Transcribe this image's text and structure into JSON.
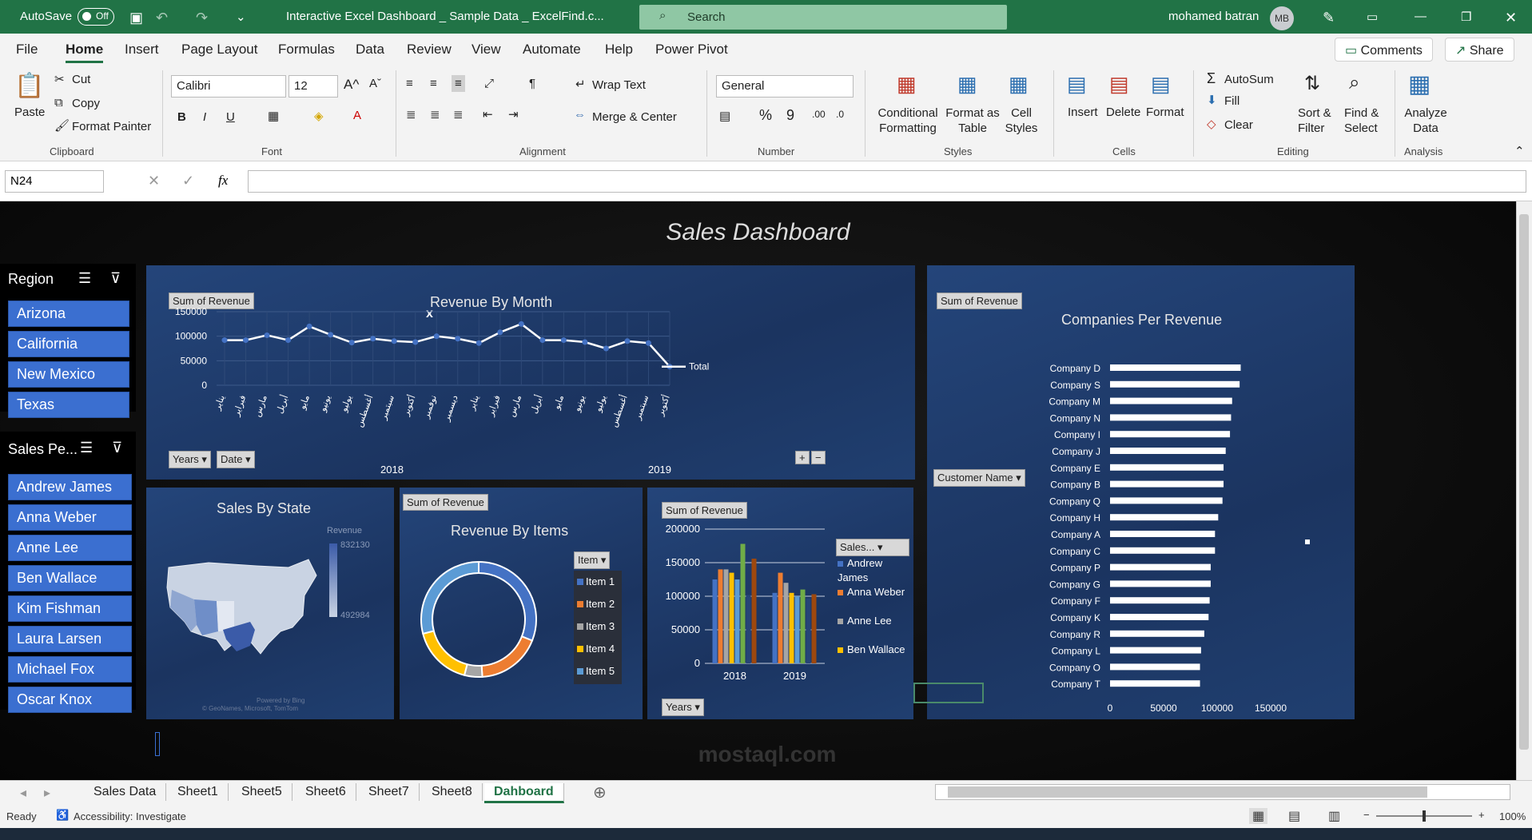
{
  "titlebar": {
    "autosave": "AutoSave",
    "toggle": "Off",
    "filename": "Interactive Excel Dashboard _ Sample Data _ ExcelFind.c...",
    "search": "Search",
    "user": "mohamed batran",
    "initials": "MB"
  },
  "menu": {
    "tabs": [
      "File",
      "Home",
      "Insert",
      "Page Layout",
      "Formulas",
      "Data",
      "Review",
      "View",
      "Automate",
      "Help",
      "Power Pivot"
    ],
    "comments": "Comments",
    "share": "Share"
  },
  "ribbon": {
    "paste": "Paste",
    "cut": "Cut",
    "copy": "Copy",
    "format_painter": "Format Painter",
    "clipboard": "Clipboard",
    "font_name": "Calibri",
    "font_size": "12",
    "font": "Font",
    "wrap_text": "Wrap Text",
    "merge_center": "Merge & Center",
    "alignment": "Alignment",
    "number_format": "General",
    "number": "Number",
    "cond_format": "Conditional Formatting",
    "format_table": "Format as Table",
    "cell_styles": "Cell Styles",
    "styles": "Styles",
    "insert": "Insert",
    "delete": "Delete",
    "format": "Format",
    "cells": "Cells",
    "autosum": "AutoSum",
    "fill": "Fill",
    "clear": "Clear",
    "sort_filter": "Sort & Filter",
    "find_select": "Find & Select",
    "editing": "Editing",
    "analyze": "Analyze Data",
    "analysis": "Analysis"
  },
  "formula": {
    "namebox": "N24",
    "fx": "fx"
  },
  "dashboard": {
    "title": "Sales Dashboard",
    "region": {
      "header": "Region",
      "items": [
        "Arizona",
        "California",
        "New Mexico",
        "Texas"
      ]
    },
    "salesperson": {
      "header": "Sales Pe...",
      "items": [
        "Andrew James",
        "Anna Weber",
        "Anne Lee",
        "Ben Wallace",
        "Kim Fishman",
        "Laura Larsen",
        "Michael Fox",
        "Oscar Knox"
      ]
    },
    "tags": {
      "sum_rev": "Sum of Revenue",
      "years": "Years",
      "date": "Date",
      "item": "Item",
      "customer": "Customer Name",
      "sales": "Sales..."
    },
    "map": {
      "title": "Sales By State",
      "legend": "Revenue",
      "max": "832130",
      "min": "492984",
      "credit1": "Powered by Bing",
      "credit2": "© GeoNames, Microsoft, TomTom"
    }
  },
  "chart_data": [
    {
      "type": "line",
      "title": "Revenue By Month",
      "ylim": [
        0,
        150000
      ],
      "yticks": [
        "150000",
        "100000",
        "50000",
        "0"
      ],
      "series": [
        {
          "name": "Total",
          "values": [
            92000,
            92000,
            102000,
            92000,
            120000,
            103000,
            87000,
            95000,
            90000,
            88000,
            100000,
            95000,
            86000,
            108000,
            125000,
            92000,
            92000,
            88000,
            75000,
            90000,
            86000,
            38000
          ]
        }
      ],
      "groups": [
        "2018",
        "2019"
      ],
      "x": [
        "يناير",
        "فبراير",
        "مارس",
        "أبريل",
        "مايو",
        "يونيو",
        "يوليو",
        "أغسطس",
        "سبتمبر",
        "أكتوبر",
        "نوفمبر",
        "ديسمبر",
        "يناير",
        "فبراير",
        "مارس",
        "أبريل",
        "مايو",
        "يونيو",
        "يوليو",
        "أغسطس",
        "سبتمبر",
        "أكتوبر"
      ]
    },
    {
      "type": "pie",
      "title": "Revenue By Items",
      "categories": [
        "Item 1",
        "Item 2",
        "Item 3",
        "Item 4",
        "Item 5"
      ],
      "values": [
        31,
        18,
        5,
        17,
        29
      ],
      "colors": [
        "#4472c4",
        "#ed7d31",
        "#a5a5a5",
        "#ffc000",
        "#5b9bd5"
      ]
    },
    {
      "type": "bar",
      "title": "",
      "categories": [
        "2018",
        "2019"
      ],
      "ylim": [
        0,
        200000
      ],
      "yticks": [
        "200000",
        "150000",
        "100000",
        "50000",
        "0"
      ],
      "series": [
        {
          "name": "Andrew James",
          "values": [
            125000,
            105000
          ],
          "color": "#4472c4"
        },
        {
          "name": "Anna Weber",
          "values": [
            140000,
            135000
          ],
          "color": "#ed7d31"
        },
        {
          "name": "Anne Lee",
          "values": [
            140000,
            120000
          ],
          "color": "#a5a5a5"
        },
        {
          "name": "Ben Wallace",
          "values": [
            135000,
            105000
          ],
          "color": "#ffc000"
        },
        {
          "name": "Kim Fishman",
          "values": [
            125000,
            100000
          ],
          "color": "#5b9bd5"
        },
        {
          "name": "Laura Larsen",
          "values": [
            178000,
            110000
          ],
          "color": "#70ad47"
        },
        {
          "name": "Michael Fox",
          "values": [
            102000,
            97000
          ],
          "color": "#264478"
        },
        {
          "name": "Oscar Knox",
          "values": [
            156000,
            103000
          ],
          "color": "#9e480e"
        }
      ],
      "legend": [
        "Andrew James",
        "Anna Weber",
        "Anne Lee",
        "Ben Wallace"
      ]
    },
    {
      "type": "bar",
      "title": "Companies Per Revenue",
      "categories": [
        "Company D",
        "Company S",
        "Company M",
        "Company N",
        "Company I",
        "Company J",
        "Company E",
        "Company B",
        "Company Q",
        "Company H",
        "Company A",
        "Company C",
        "Company P",
        "Company G",
        "Company F",
        "Company K",
        "Company R",
        "Company L",
        "Company O",
        "Company T"
      ],
      "values": [
        122000,
        121000,
        114000,
        113000,
        112000,
        108000,
        106000,
        106000,
        105000,
        101000,
        98000,
        98000,
        94000,
        94000,
        93000,
        92000,
        88000,
        85000,
        84000,
        84000
      ],
      "xticks": [
        "0",
        "50000",
        "100000",
        "150000"
      ],
      "xlim": [
        0,
        150000
      ]
    }
  ],
  "sheets": {
    "tabs": [
      "Sales Data",
      "Sheet1",
      "Sheet5",
      "Sheet6",
      "Sheet7",
      "Sheet8",
      "Dahboard"
    ]
  },
  "status": {
    "ready": "Ready",
    "accessibility": "Accessibility: Investigate",
    "zoom": "100%"
  },
  "watermark": "mostaql.com"
}
